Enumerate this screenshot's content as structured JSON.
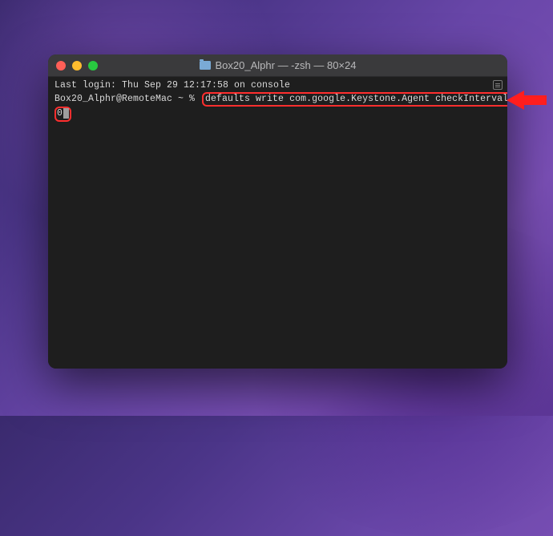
{
  "window": {
    "title": "Box20_Alphr — -zsh — 80×24"
  },
  "terminal": {
    "last_login": "Last login: Thu Sep 29 12:17:58 on console",
    "prompt": "Box20_Alphr@RemoteMac ~ %",
    "command_part1": "defaults write com.google.Keystone.Agent checkInterval",
    "command_part2": "0"
  }
}
